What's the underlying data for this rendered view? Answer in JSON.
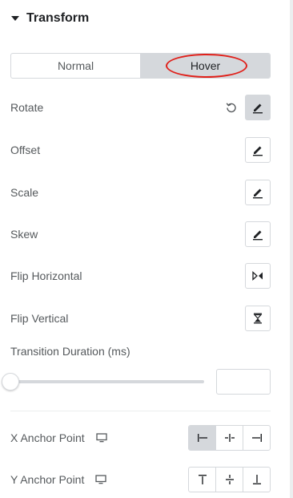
{
  "section": {
    "title": "Transform"
  },
  "tabs": [
    {
      "label": "Normal",
      "active": false
    },
    {
      "label": "Hover",
      "active": true
    }
  ],
  "annotation_color": "#e0201a",
  "rows": {
    "rotate": "Rotate",
    "offset": "Offset",
    "scale": "Scale",
    "skew": "Skew",
    "flip_horizontal": "Flip Horizontal",
    "flip_vertical": "Flip Vertical"
  },
  "icons": {
    "edit": "pencil-icon",
    "reset": "reset-icon",
    "flip_horizontal": "flip-horizontal-icon",
    "flip_vertical": "flip-vertical-icon",
    "device": "desktop-icon"
  },
  "transition": {
    "label": "Transition Duration (ms)",
    "value": "",
    "slider_fraction": 0
  },
  "x_anchor": {
    "label": "X Anchor Point",
    "options": [
      "left",
      "center",
      "right"
    ],
    "selected": "left"
  },
  "y_anchor": {
    "label": "Y Anchor Point",
    "options": [
      "top",
      "center",
      "bottom"
    ],
    "selected": null
  },
  "colors": {
    "active_bg": "#d5d8dc",
    "border": "#d5d8dc",
    "text": "#55595c",
    "heading": "#1f2124"
  }
}
